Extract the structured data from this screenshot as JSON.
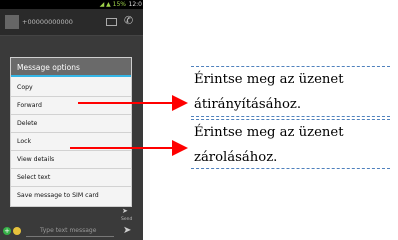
{
  "phone": {
    "status_icons": "◢ ▲ 15%",
    "status_time": "12:0",
    "contact_number": "+00000000000",
    "menu_title": "Message options",
    "menu_items": [
      {
        "label": "Copy"
      },
      {
        "label": "Forward"
      },
      {
        "label": "Delete"
      },
      {
        "label": "Lock"
      },
      {
        "label": "View details"
      },
      {
        "label": "Select text"
      },
      {
        "label": "Save message to SIM card"
      }
    ],
    "send_mini_label": "Send",
    "input_placeholder": "Type text message"
  },
  "callouts": [
    {
      "line1": "Érintse meg az üzenet",
      "line2": "átirányításához."
    },
    {
      "line1": "Érintse meg az üzenet",
      "line2": "zárolásához."
    }
  ],
  "colors": {
    "arrow": "#ff0000",
    "callout_border": "#4f81bd",
    "dialog_accent": "#34b5e5"
  }
}
